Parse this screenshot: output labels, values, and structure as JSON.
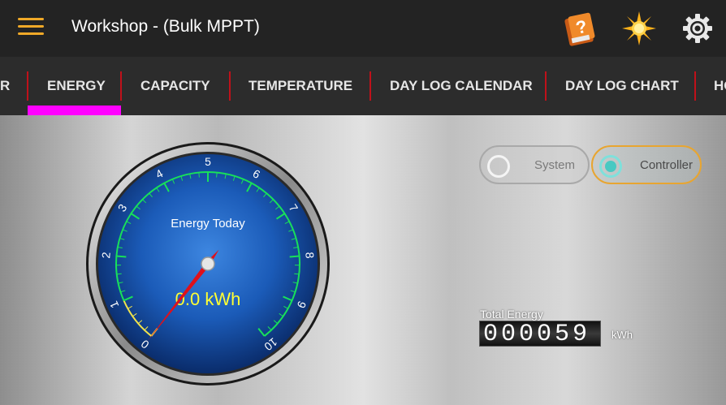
{
  "appbar": {
    "title": "Workshop - (Bulk MPPT)",
    "icons": [
      "menu-icon",
      "help-book-icon",
      "sun-icon",
      "gear-icon"
    ],
    "accent_color": "#f0a928"
  },
  "tabs": [
    {
      "label": "R",
      "active": false
    },
    {
      "label": "ENERGY",
      "active": true
    },
    {
      "label": "CAPACITY",
      "active": false
    },
    {
      "label": "TEMPERATURE",
      "active": false
    },
    {
      "label": "DAY LOG CALENDAR",
      "active": false
    },
    {
      "label": "DAY LOG CHART",
      "active": false
    },
    {
      "label": "HO",
      "active": false
    }
  ],
  "tab_indicator_color": "#ff00ff",
  "source_toggle": {
    "system_label": "System",
    "controller_label": "Controller",
    "selected": "Controller"
  },
  "gauge": {
    "title": "Energy Today",
    "value_text": "0.0 kWh",
    "value": 0.0,
    "min": 0,
    "max": 10,
    "ticks": [
      "0",
      "1",
      "2",
      "3",
      "4",
      "5",
      "6",
      "7",
      "8",
      "9",
      "10"
    ],
    "face_color": "#1b5bb8",
    "arc_color": "#18e05a",
    "low_arc_color": "#f1e34b",
    "needle_color": "#e0101a",
    "value_color": "#ffff33"
  },
  "total_energy": {
    "label": "Total Energy",
    "value": "000059",
    "unit": "kWh"
  }
}
